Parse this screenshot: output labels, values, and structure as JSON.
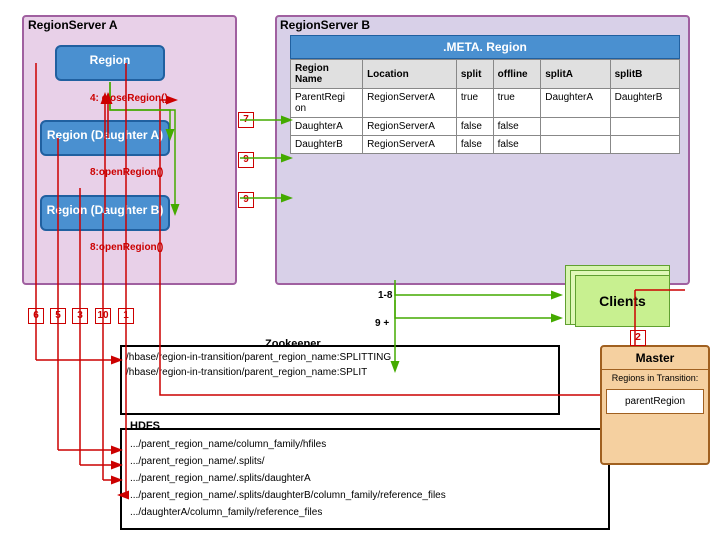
{
  "regionServerA": {
    "label": "RegionServer A",
    "regions": [
      {
        "name": "Region",
        "id": "region-main"
      },
      {
        "name": "Region (Daughter A)",
        "id": "region-daughter-a"
      },
      {
        "name": "Region (Daughter B)",
        "id": "region-daughter-b"
      }
    ],
    "arrowLabels": [
      {
        "text": "4: closeRegion()",
        "id": "close-region-label"
      },
      {
        "text": "8:openRegion()",
        "id": "open-region-a-label"
      },
      {
        "text": "8:openRegion()",
        "id": "open-region-b-label"
      }
    ]
  },
  "regionServerB": {
    "label": "RegionServer B"
  },
  "metaTable": {
    "title": ".META. Region",
    "headers": [
      "Region Name",
      "Location",
      "split",
      "offline",
      "splitA",
      "splitB"
    ],
    "rows": [
      [
        "ParentRegion",
        "RegionServerA",
        "true",
        "true",
        "DaughterA",
        "DaughterB"
      ],
      [
        "DaughterA",
        "RegionServerA",
        "false",
        "false",
        "",
        ""
      ],
      [
        "DaughterB",
        "RegionServerA",
        "false",
        "false",
        "",
        ""
      ]
    ]
  },
  "zookeeper": {
    "label": "Zookeeper",
    "lines": [
      "/hbase/region-in-transition/parent_region_name:SPLITTING",
      "/hbase/region-in-transition/parent_region_name:SPLIT"
    ]
  },
  "hdfs": {
    "label": "HDFS",
    "lines": [
      ".../parent_region_name/column_family/hfiles",
      ".../parent_region_name/.splits/",
      ".../parent_region_name/.splits/daughterA",
      ".../parent_region_name/.splits/daughterB/column_family/reference_files",
      ".../daughterA/column_family/reference_files"
    ]
  },
  "clients": {
    "label": "Clients"
  },
  "master": {
    "label": "Master",
    "regionsInTransition": "Regions in Transition:",
    "parentRegion": "parentRegion"
  },
  "stepNumbers": {
    "n1": "1",
    "n2": "2",
    "n3": "3",
    "n4": "4",
    "n5": "5",
    "n6": "6",
    "n7": "7",
    "n8": "8",
    "n9": "9",
    "n10": "10",
    "n1_8": "1-8",
    "n9plus": "9 +"
  },
  "colors": {
    "regionBlue": "#4a8ec2",
    "serverPurple": "#d0b8d8",
    "arrowRed": "#cc0000",
    "arrowGreen": "#44aa00"
  }
}
